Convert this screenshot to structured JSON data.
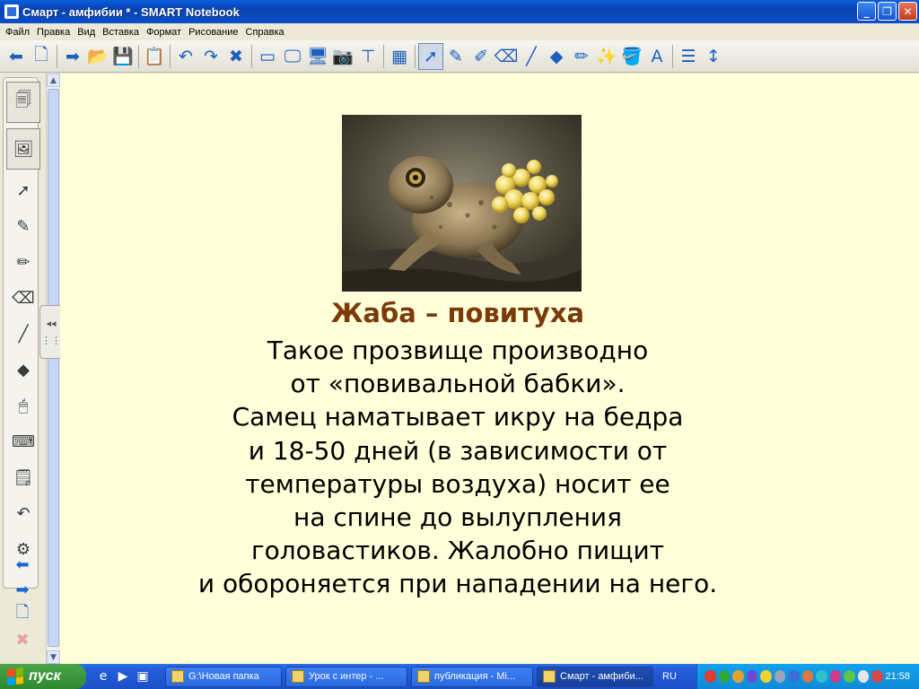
{
  "window": {
    "title": "Смарт - амфибии * - SMART Notebook"
  },
  "window_buttons": [
    "_",
    "❐",
    "✕"
  ],
  "menu": [
    "Файл",
    "Правка",
    "Вид",
    "Вставка",
    "Формат",
    "Рисование",
    "Справка"
  ],
  "toolbar": {
    "groups": [
      [
        {
          "name": "back-icon",
          "glyph": "⬅"
        },
        {
          "name": "new-page-icon",
          "glyph": "🗋"
        }
      ],
      [
        {
          "name": "forward-icon",
          "glyph": "➡"
        },
        {
          "name": "open-folder-icon",
          "glyph": "📂"
        },
        {
          "name": "save-icon",
          "glyph": "💾"
        }
      ],
      [
        {
          "name": "paste-icon",
          "glyph": "📋"
        }
      ],
      [
        {
          "name": "undo-icon",
          "glyph": "↶"
        },
        {
          "name": "redo-icon",
          "glyph": "↷"
        },
        {
          "name": "delete-icon",
          "glyph": "✖"
        }
      ],
      [
        {
          "name": "screen-shade-icon",
          "glyph": "▭"
        },
        {
          "name": "full-screen-icon",
          "glyph": "🖵"
        },
        {
          "name": "dual-page-icon",
          "glyph": "🖥"
        },
        {
          "name": "screen-capture-icon",
          "glyph": "📷"
        },
        {
          "name": "document-camera-icon",
          "glyph": "⊤"
        }
      ],
      [
        {
          "name": "table-icon",
          "glyph": "▦"
        }
      ],
      [
        {
          "name": "select-icon",
          "glyph": "➚",
          "selected": true
        },
        {
          "name": "pen-icon",
          "glyph": "✎"
        },
        {
          "name": "creative-pen-icon",
          "glyph": "✐"
        },
        {
          "name": "eraser-icon",
          "glyph": "⌫"
        },
        {
          "name": "line-icon",
          "glyph": "╱"
        },
        {
          "name": "shapes-icon",
          "glyph": "◆"
        },
        {
          "name": "magic-pen-icon",
          "glyph": "✏"
        },
        {
          "name": "shape-recognition-pen-icon",
          "glyph": "✨"
        },
        {
          "name": "fill-icon",
          "glyph": "🪣"
        },
        {
          "name": "text-icon",
          "glyph": "A"
        }
      ],
      [
        {
          "name": "properties-icon",
          "glyph": "☰"
        },
        {
          "name": "move-toolbar-icon",
          "glyph": "↕"
        }
      ]
    ]
  },
  "sidebar": {
    "buttons": [
      {
        "name": "page-sorter-icon",
        "glyph": "🗐",
        "big": true
      },
      {
        "name": "gallery-icon",
        "glyph": "🖼",
        "big": true
      },
      {
        "name": "select-tool-icon",
        "glyph": "➚"
      },
      {
        "name": "pen-tool-icon",
        "glyph": "✎"
      },
      {
        "name": "highlighter-tool-icon",
        "glyph": "✏"
      },
      {
        "name": "eraser-tool-icon",
        "glyph": "⌫"
      },
      {
        "name": "line-tool-icon",
        "glyph": "╱"
      },
      {
        "name": "shape-tool-icon",
        "glyph": "◆"
      },
      {
        "name": "mouse-tool-icon",
        "glyph": "🖱"
      },
      {
        "name": "keyboard-icon",
        "glyph": "⌨"
      },
      {
        "name": "recognition-icon",
        "glyph": "🗒"
      },
      {
        "name": "undo-icon",
        "glyph": "↶"
      },
      {
        "name": "settings-icon",
        "glyph": "⚙"
      }
    ],
    "nav": [
      {
        "name": "previous-page-icon",
        "glyph": "⬅"
      },
      {
        "name": "next-page-icon",
        "glyph": "➡"
      },
      {
        "name": "add-page-icon",
        "glyph": "🗋"
      },
      {
        "name": "delete-page-icon",
        "glyph": "✖"
      }
    ],
    "collapse_glyph": "◂◂"
  },
  "slide": {
    "heading": "Жаба – повитуха",
    "lines": [
      "Такое прозвище производно",
      "от «повивальной бабки».",
      "Самец наматывает икру на бедра",
      "и 18-50 дней (в зависимости от",
      "температуры воздуха) носит ее",
      "на спине до вылупления",
      "головастиков. Жалобно пищит",
      "и обороняется при нападении на него."
    ],
    "colors": {
      "background": "#ffffd9",
      "heading": "#7a3b08",
      "text": "#000000"
    }
  },
  "taskbar": {
    "start_label": "пуск",
    "quick_launch": [
      {
        "name": "internet-explorer-icon",
        "glyph": "e"
      },
      {
        "name": "media-player-icon",
        "glyph": "▶"
      },
      {
        "name": "show-desktop-icon",
        "glyph": "▣"
      }
    ],
    "tasks": [
      {
        "label": "G:\\Новая папка",
        "active": false
      },
      {
        "label": "Урок с интер - ...",
        "active": false
      },
      {
        "label": "публикация - Mi...",
        "active": false
      },
      {
        "label": "Смарт - амфиби...",
        "active": true
      }
    ],
    "language": "RU",
    "tray_icons": [
      "#e03b2f",
      "#2fa63a",
      "#e0a22f",
      "#6b4bd1",
      "#f0d02a",
      "#9aa5b8",
      "#3a6fd8",
      "#e0763b",
      "#2ec0c8",
      "#d33a86",
      "#5bc54b",
      "#e6e6e6",
      "#d54848"
    ],
    "clock": "21:58"
  }
}
